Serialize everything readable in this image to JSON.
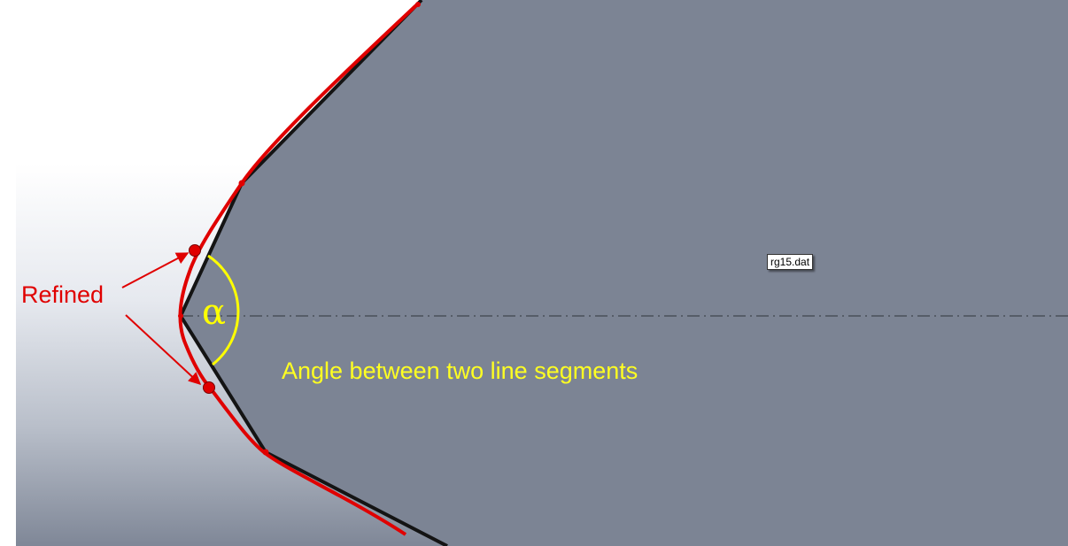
{
  "file_tag": "rg15.dat",
  "labels": {
    "refined": "Refined",
    "alpha": "α",
    "angle_caption": "Angle between two line segments"
  },
  "colors": {
    "body_fill": "#7c8494",
    "polyline": "#141414",
    "refined_curve": "#e00000",
    "annotation": "#ffff00",
    "centerline": "#4a505a"
  }
}
